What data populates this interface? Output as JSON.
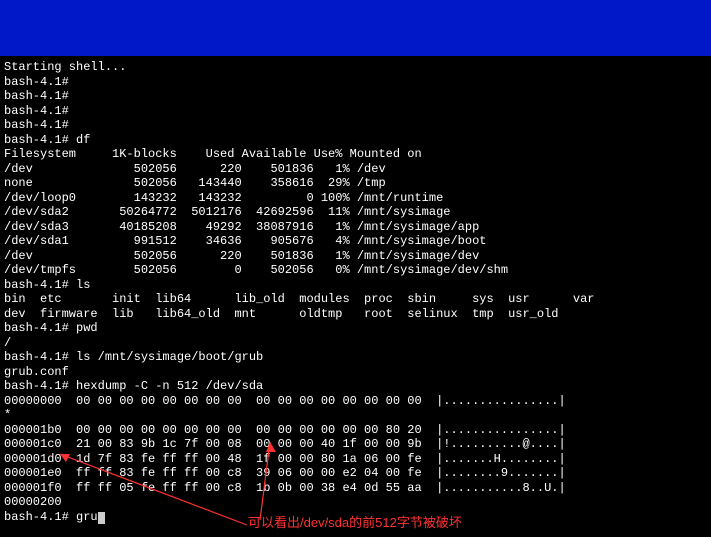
{
  "shell_start": "Starting shell...",
  "prompt": "bash-4.1#",
  "prompts_blank_count": 4,
  "cmd_df": "df",
  "df": {
    "header": "Filesystem     1K-blocks    Used Available Use% Mounted on",
    "rows": [
      {
        "fs": "/dev",
        "blk": "502056",
        "used": "220",
        "avail": "501836",
        "pct": "1%",
        "mnt": "/dev"
      },
      {
        "fs": "none",
        "blk": "502056",
        "used": "143440",
        "avail": "358616",
        "pct": "29%",
        "mnt": "/tmp"
      },
      {
        "fs": "/dev/loop0",
        "blk": "143232",
        "used": "143232",
        "avail": "0",
        "pct": "100%",
        "mnt": "/mnt/runtime"
      },
      {
        "fs": "/dev/sda2",
        "blk": "50264772",
        "used": "5012176",
        "avail": "42692596",
        "pct": "11%",
        "mnt": "/mnt/sysimage"
      },
      {
        "fs": "/dev/sda3",
        "blk": "40185208",
        "used": "49292",
        "avail": "38087916",
        "pct": "1%",
        "mnt": "/mnt/sysimage/app"
      },
      {
        "fs": "/dev/sda1",
        "blk": "991512",
        "used": "34636",
        "avail": "905676",
        "pct": "4%",
        "mnt": "/mnt/sysimage/boot"
      },
      {
        "fs": "/dev",
        "blk": "502056",
        "used": "220",
        "avail": "501836",
        "pct": "1%",
        "mnt": "/mnt/sysimage/dev"
      },
      {
        "fs": "/dev/tmpfs",
        "blk": "502056",
        "used": "0",
        "avail": "502056",
        "pct": "0%",
        "mnt": "/mnt/sysimage/dev/shm"
      }
    ]
  },
  "cmd_ls": "ls",
  "ls_out": [
    "bin  etc       init  lib64      lib_old  modules  proc  sbin     sys  usr      var",
    "dev  firmware  lib   lib64_old  mnt      oldtmp   root  selinux  tmp  usr_old"
  ],
  "cmd_pwd": "pwd",
  "pwd_out": "/",
  "cmd_ls2": "ls /mnt/sysimage/boot/grub",
  "ls2_out": "grub.conf",
  "cmd_hex": "hexdump -C -n 512 /dev/sda",
  "hex": [
    {
      "off": "00000000",
      "b": "00 00 00 00 00 00 00 00  00 00 00 00 00 00 00 00",
      "a": "|................|"
    },
    {
      "off": "*",
      "b": "",
      "a": ""
    },
    {
      "off": "000001b0",
      "b": "00 00 00 00 00 00 00 00  00 00 00 00 00 00 80 20",
      "a": "|................|"
    },
    {
      "off": "000001c0",
      "b": "21 00 83 9b 1c 7f 00 08  00 00 00 40 1f 00 00 9b",
      "a": "|!..........@....|"
    },
    {
      "off": "000001d0",
      "b": "1d 7f 83 fe ff ff 00 48  1f 00 00 80 1a 06 00 fe",
      "a": "|.......H........|"
    },
    {
      "off": "000001e0",
      "b": "ff ff 83 fe ff ff 00 c8  39 06 00 00 e2 04 00 fe",
      "a": "|........9.......|"
    },
    {
      "off": "000001f0",
      "b": "ff ff 05 fe ff ff 00 c8  1b 0b 00 38 e4 0d 55 aa",
      "a": "|...........8..U.|"
    },
    {
      "off": "00000200",
      "b": "",
      "a": ""
    }
  ],
  "current_cmd": "gru",
  "annotation": "可以看出/dev/sda的前512字节被破坏"
}
